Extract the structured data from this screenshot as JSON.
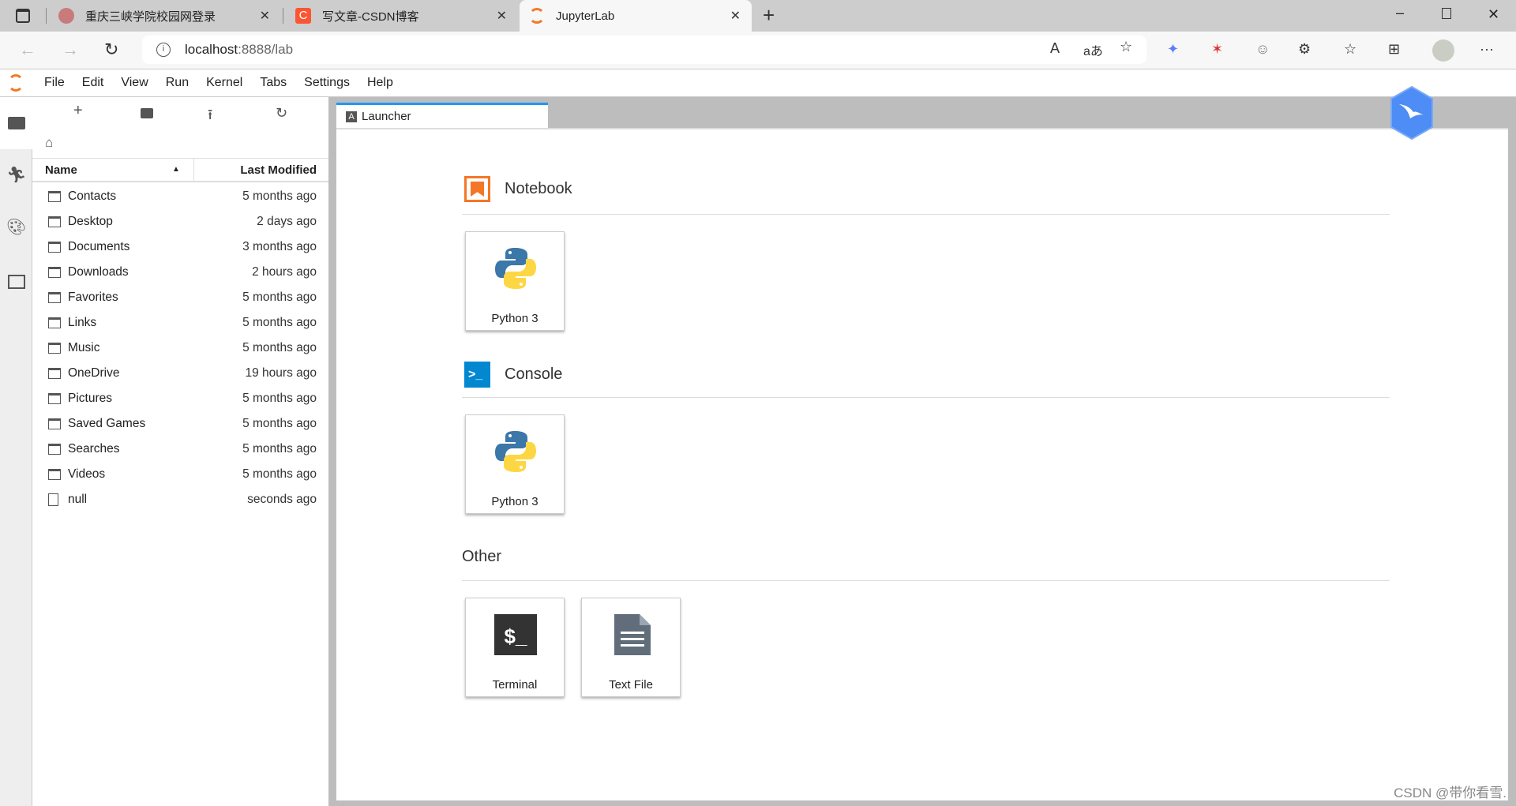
{
  "browser": {
    "tabs": [
      {
        "title": "重庆三峡学院校园网登录",
        "favicon": "#c97b7b"
      },
      {
        "title": "写文章-CSDN博客",
        "favicon": "#fc5531"
      },
      {
        "title": "JupyterLab",
        "favicon": "#f37726",
        "active": true
      }
    ],
    "url_host": "localhost",
    "url_rest": ":8888/lab"
  },
  "menu": [
    "File",
    "Edit",
    "View",
    "Run",
    "Kernel",
    "Tabs",
    "Settings",
    "Help"
  ],
  "filebrowser": {
    "col_name": "Name",
    "col_modified": "Last Modified",
    "files": [
      {
        "name": "Contacts",
        "modified": "5 months ago",
        "type": "folder"
      },
      {
        "name": "Desktop",
        "modified": "2 days ago",
        "type": "folder"
      },
      {
        "name": "Documents",
        "modified": "3 months ago",
        "type": "folder"
      },
      {
        "name": "Downloads",
        "modified": "2 hours ago",
        "type": "folder"
      },
      {
        "name": "Favorites",
        "modified": "5 months ago",
        "type": "folder"
      },
      {
        "name": "Links",
        "modified": "5 months ago",
        "type": "folder"
      },
      {
        "name": "Music",
        "modified": "5 months ago",
        "type": "folder"
      },
      {
        "name": "OneDrive",
        "modified": "19 hours ago",
        "type": "folder"
      },
      {
        "name": "Pictures",
        "modified": "5 months ago",
        "type": "folder"
      },
      {
        "name": "Saved Games",
        "modified": "5 months ago",
        "type": "folder"
      },
      {
        "name": "Searches",
        "modified": "5 months ago",
        "type": "folder"
      },
      {
        "name": "Videos",
        "modified": "5 months ago",
        "type": "folder"
      },
      {
        "name": "null",
        "modified": "seconds ago",
        "type": "file"
      }
    ]
  },
  "launcher": {
    "tab": "Launcher",
    "notebook": {
      "title": "Notebook",
      "card": "Python 3"
    },
    "console": {
      "title": "Console",
      "card": "Python 3"
    },
    "other": {
      "title": "Other",
      "cards": [
        "Terminal",
        "Text File"
      ]
    }
  },
  "watermark": "CSDN @带你看雪.",
  "colors": {
    "accent": "#2196f3",
    "jupyter_orange": "#f37726",
    "console_blue": "#0288d1"
  }
}
